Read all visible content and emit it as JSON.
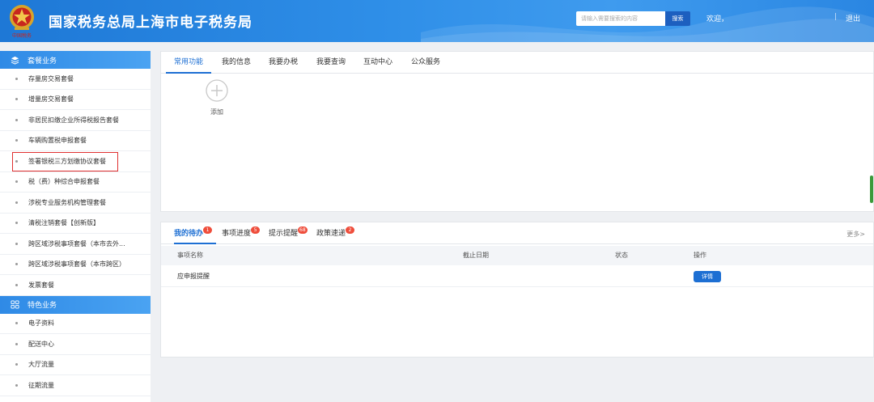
{
  "header": {
    "title": "国家税务总局上海市电子税务局",
    "emblem_caption": "中国税务",
    "search_placeholder": "请输入需要搜索的内容",
    "search_button": "搜索",
    "welcome": "欢迎，",
    "divider": "|",
    "logout": "退出"
  },
  "sidebar": {
    "section1": {
      "title": "套餐业务",
      "icon": "layers-icon",
      "items": [
        {
          "label": "存量房交易套餐"
        },
        {
          "label": "增量房交易套餐"
        },
        {
          "label": "非居民扣缴企业所得税报告套餐"
        },
        {
          "label": "车辆购置税申报套餐"
        },
        {
          "label": "签署银税三方划缴协议套餐",
          "highlighted": true
        },
        {
          "label": "税（费）种综合申报套餐"
        },
        {
          "label": "涉税专业服务机构管理套餐"
        },
        {
          "label": "清税注销套餐【创新版】"
        },
        {
          "label": "跨区域涉税事项套餐（本市去外..."
        },
        {
          "label": "跨区域涉税事项套餐（本市跨区）"
        },
        {
          "label": "发票套餐"
        }
      ]
    },
    "section2": {
      "title": "特色业务",
      "icon": "grid-icon",
      "items": [
        {
          "label": "电子资料"
        },
        {
          "label": "配送中心"
        },
        {
          "label": "大厅流量"
        },
        {
          "label": "征期流量"
        }
      ]
    }
  },
  "top_panel": {
    "tabs": [
      {
        "label": "常用功能",
        "active": true
      },
      {
        "label": "我的信息"
      },
      {
        "label": "我要办税"
      },
      {
        "label": "我要查询"
      },
      {
        "label": "互动中心"
      },
      {
        "label": "公众服务"
      }
    ],
    "add_label": "添加"
  },
  "bottom_panel": {
    "tabs": [
      {
        "label": "我的待办",
        "badge": "1",
        "active": true
      },
      {
        "label": "事项进度",
        "badge": "5"
      },
      {
        "label": "提示提醒",
        "badge": "68"
      },
      {
        "label": "政策速递",
        "badge": "2"
      }
    ],
    "more": "更多>",
    "columns": [
      "事项名称",
      "截止日期",
      "状态",
      "操作"
    ],
    "rows": [
      {
        "name": "应申报提醒",
        "deadline": "",
        "status": "",
        "action": "详情"
      }
    ]
  },
  "colors": {
    "header_blue": "#2a86e2",
    "accent_blue": "#1d6fd3",
    "badge_red": "#ef4d3b",
    "highlight_red": "#e03030"
  }
}
